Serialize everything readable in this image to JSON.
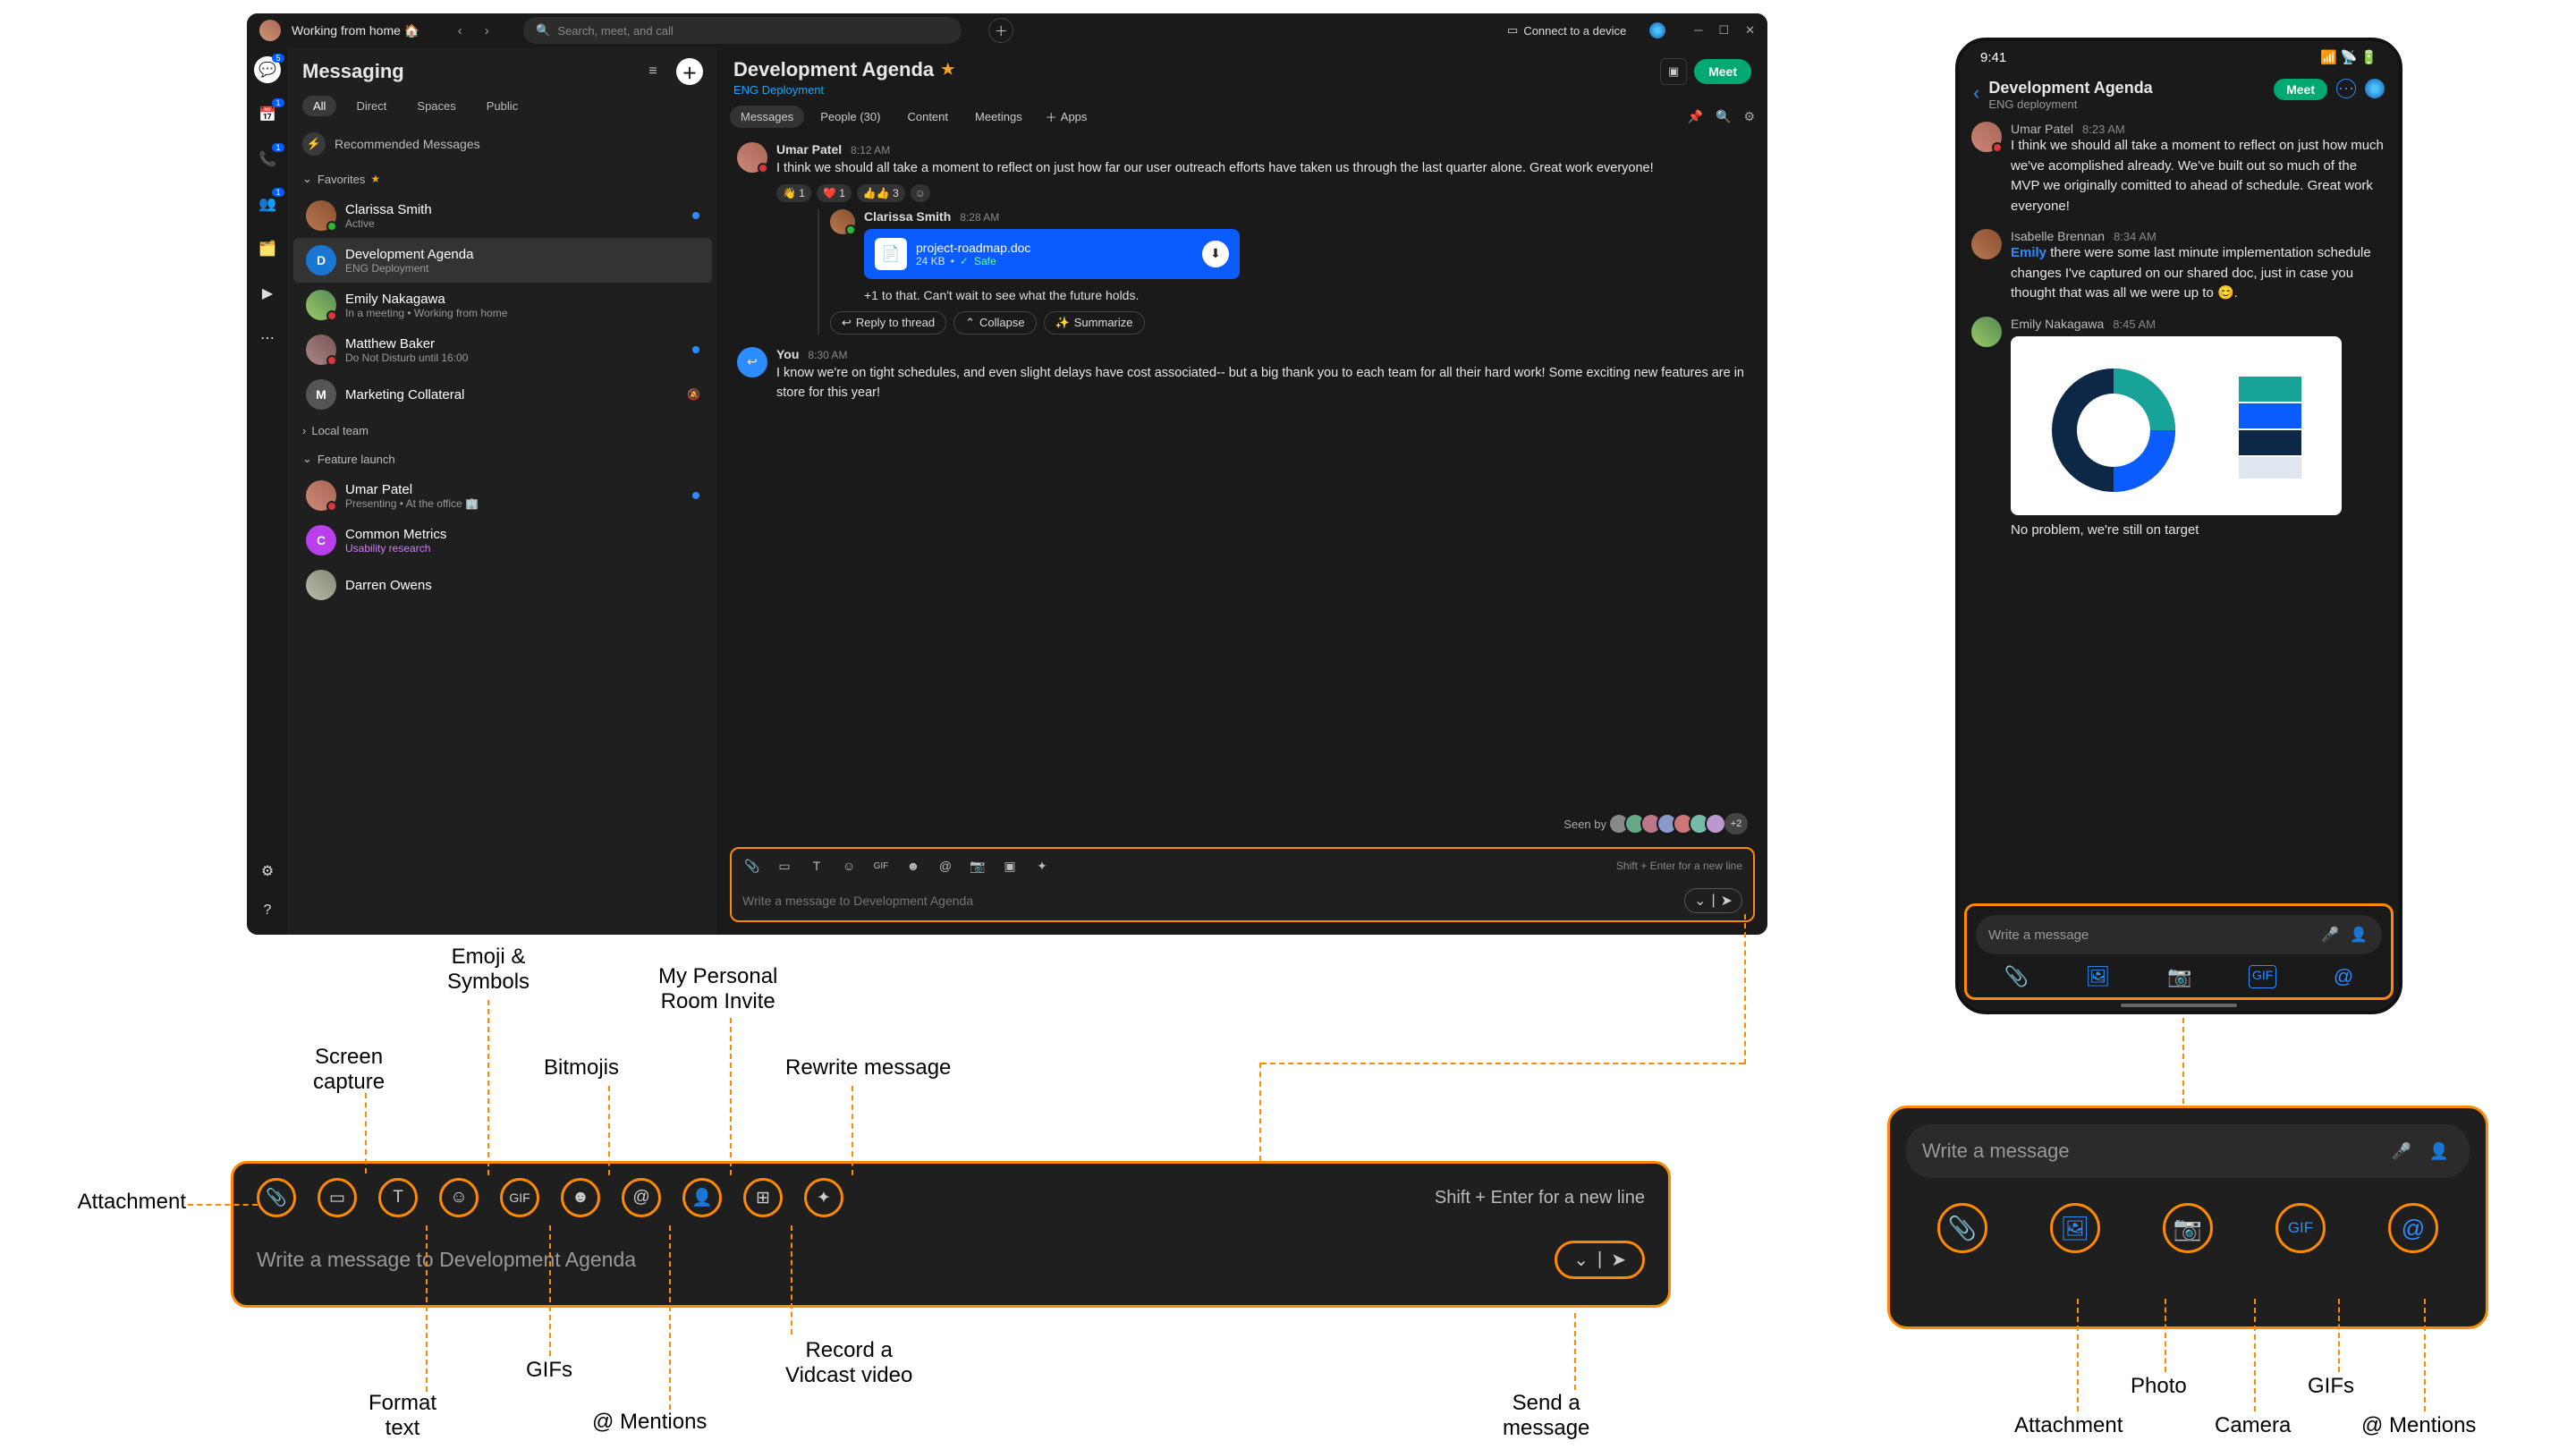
{
  "desktop": {
    "titlebar": {
      "status": "Working from home 🏠",
      "search_placeholder": "Search, meet, and call",
      "connect": "Connect to a device"
    },
    "rail": {
      "chat_badge": "5",
      "calendar_badge": "1",
      "phone_badge": "1",
      "teams_badge": "1"
    },
    "sidebar": {
      "title": "Messaging",
      "filters": {
        "all": "All",
        "direct": "Direct",
        "spaces": "Spaces",
        "public": "Public"
      },
      "recommended": "Recommended Messages",
      "sections": {
        "fav": "Favorites",
        "local": "Local team",
        "feature": "Feature launch"
      },
      "items": {
        "clarissa": {
          "name": "Clarissa Smith",
          "sub": "Active"
        },
        "dev": {
          "name": "Development Agenda",
          "sub": "ENG Deployment"
        },
        "emily": {
          "name": "Emily Nakagawa",
          "sub": "In a meeting  •  Working from home"
        },
        "matt": {
          "name": "Matthew Baker",
          "sub": "Do Not Disturb until 16:00"
        },
        "marketing": {
          "name": "Marketing Collateral"
        },
        "umar": {
          "name": "Umar Patel",
          "sub": "Presenting  •  At the office 🏢"
        },
        "common": {
          "name": "Common Metrics",
          "sub": "Usability research"
        },
        "darren": {
          "name": "Darren Owens"
        }
      }
    },
    "chat": {
      "title": "Development Agenda",
      "sub": "ENG Deployment",
      "meet": "Meet",
      "tabs": {
        "messages": "Messages",
        "people": "People (30)",
        "content": "Content",
        "meetings": "Meetings",
        "apps": "Apps"
      },
      "msg1": {
        "name": "Umar Patel",
        "time": "8:12 AM",
        "text": "I think we should all take a moment to reflect on just how far our user outreach efforts have taken us through the last quarter alone. Great work everyone!",
        "reactions": {
          "a": "👋 1",
          "b": "❤️ 1",
          "c": "👍👍 3"
        }
      },
      "reply1": {
        "name": "Clarissa Smith",
        "time": "8:28 AM",
        "file": {
          "name": "project-roadmap.doc",
          "size": "24 KB",
          "safe": "Safe"
        },
        "plus": "+1 to that. Can't wait to see what the future holds."
      },
      "actions": {
        "reply": "Reply to thread",
        "collapse": "Collapse",
        "summarize": "Summarize"
      },
      "msg2": {
        "name": "You",
        "time": "8:30 AM",
        "text": "I know we're on tight schedules, and even slight delays have cost associated-- but a big thank you to each team for all their hard work! Some exciting new features are in store for this year!"
      },
      "seen_by": "Seen by",
      "seen_more": "+2",
      "compose": {
        "hint": "Shift + Enter for a new line",
        "placeholder": "Write a message to Development Agenda"
      }
    }
  },
  "enlarged": {
    "hint": "Shift + Enter for a new line",
    "placeholder": "Write a message to Development Agenda",
    "labels": {
      "attachment": "Attachment",
      "screen": "Screen\ncapture",
      "emoji": "Emoji &\nSymbols",
      "format": "Format\ntext",
      "gifs": "GIFs",
      "bitmoji": "Bitmojis",
      "mentions": "@ Mentions",
      "personal": "My Personal\nRoom Invite",
      "vidcast": "Record a\nVidcast video",
      "rewrite": "Rewrite message",
      "send": "Send a\nmessage"
    }
  },
  "mobile": {
    "time": "9:41",
    "title": "Development Agenda",
    "sub": "ENG deployment",
    "meet": "Meet",
    "msg1": {
      "name": "Umar Patel",
      "time": "8:23 AM",
      "text": "I think we should all take a moment to reflect on just how much we've acomplished already. We've built out so much of the MVP we originally comitted to ahead of schedule. Great work everyone!"
    },
    "msg2": {
      "name": "Isabelle Brennan",
      "time": "8:34 AM",
      "mention": "Emily",
      "text": " there were some last minute implementation schedule changes I've captured on our shared doc, just in case you thought that was all we were up to 😊."
    },
    "msg3": {
      "name": "Emily Nakagawa",
      "time": "8:45 AM",
      "text": "No problem, we're still on target"
    },
    "compose_placeholder": "Write a message"
  },
  "mobile_enlarged": {
    "placeholder": "Write a message",
    "labels": {
      "attachment": "Attachment",
      "photo": "Photo",
      "camera": "Camera",
      "gifs": "GIFs",
      "mentions": "@ Mentions"
    }
  }
}
